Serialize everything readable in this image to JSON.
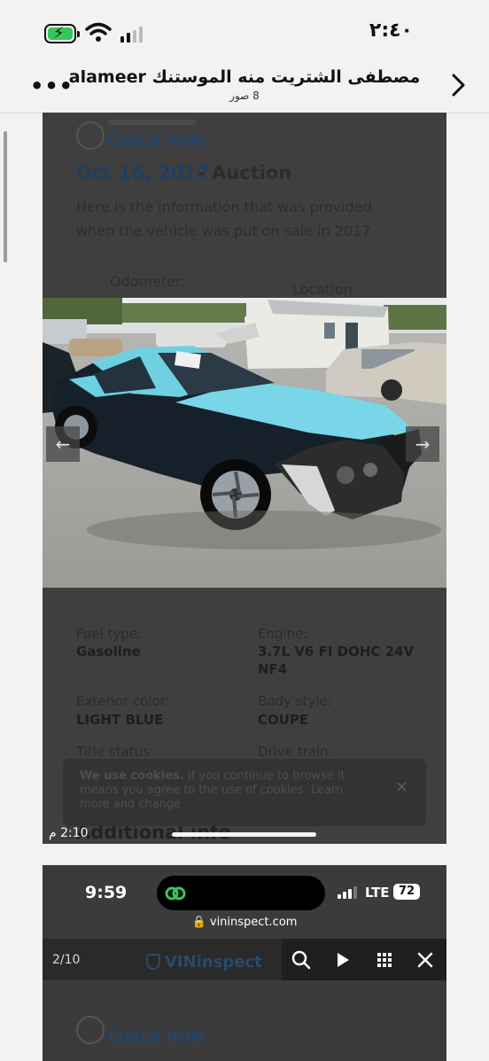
{
  "status_bar": {
    "time": "٢:٤٠",
    "battery_state": "charging",
    "wifi": "full",
    "signal_bars": 2
  },
  "header": {
    "more_label": "•••",
    "title": "مصطفى الشتريت منه الموستنك alameer",
    "subtitle": "8 صور",
    "back_icon": "chevron-right-icon"
  },
  "post1": {
    "check_now": "CHECK NOW",
    "auction_date": "Oct 16, 2017",
    "auction_label": " - Auction",
    "info_line1": "Here is the information that was provided",
    "info_line2": "when the vehicle was put on sale in 2017",
    "odometer_label": "Odometer:",
    "location_label": "Location:",
    "specs": [
      {
        "label": "Fuel type:",
        "value": "Gasoline"
      },
      {
        "label": "Engine:",
        "value": "3.7L V6 FI DOHC 24V NF4"
      },
      {
        "label": "Exterior color:",
        "value": "LIGHT BLUE"
      },
      {
        "label": "Body style:",
        "value": "COUPE"
      },
      {
        "label": "Title status:",
        "value": ""
      },
      {
        "label": "Drive train:",
        "value": ""
      }
    ],
    "cookie": {
      "bold": "We use cookies.",
      "text": " If you continue to browse it means you agree to the use of cookies. Learn more and change",
      "close": "✕"
    },
    "additional_info": "Additional info",
    "timestamp": "2:10 م",
    "nav_prev": "←",
    "nav_next": "→"
  },
  "post2": {
    "time": "9:59",
    "network": "LTE",
    "battery": "72",
    "url": "vininspect.com",
    "counter": "2/10",
    "brand": "VINinspect",
    "check_now": "CHECK NOW",
    "toolbar_icons": [
      "search-icon",
      "play-icon",
      "grid-icon",
      "close-icon"
    ]
  }
}
